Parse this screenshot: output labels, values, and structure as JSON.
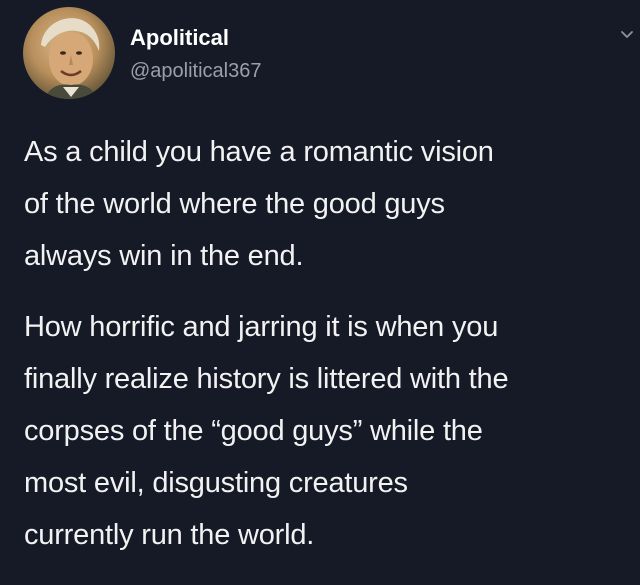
{
  "tweet": {
    "display_name": "Apolitical",
    "handle": "@apolitical367",
    "paragraphs": [
      {
        "lines": [
          "As a child you have a romantic vision",
          "of the world where the good guys",
          "always win in the end."
        ]
      },
      {
        "lines": [
          "How horrific and jarring it is when you",
          "finally realize history is littered with the",
          "corpses of the “good guys” while the",
          "most evil, disgusting creatures",
          "currently run the world."
        ]
      }
    ]
  },
  "icons": {
    "avatar": "portrait-avatar",
    "menu": "chevron-down-icon"
  },
  "colors": {
    "background": "#151a26",
    "text": "#f2f2f2",
    "handle": "#9aa0aa"
  }
}
